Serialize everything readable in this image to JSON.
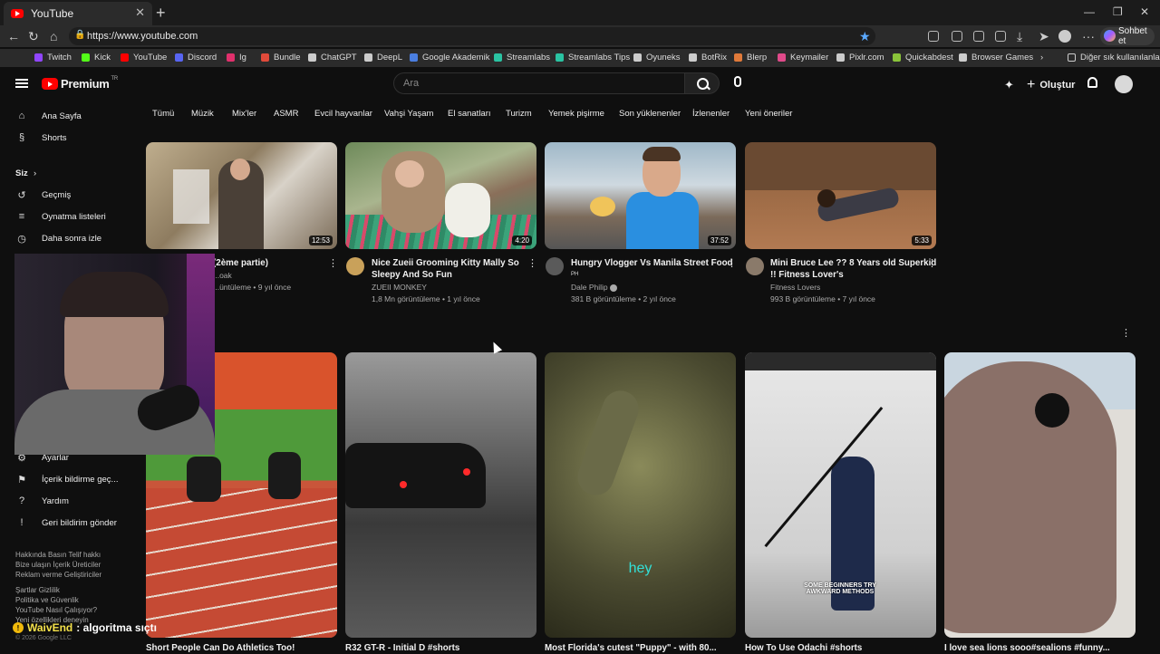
{
  "browser": {
    "tab_title": "YouTube",
    "url": "https://www.youtube.com",
    "copilot_label": "Sohbet et",
    "bookmarks": [
      "Twitch",
      "Kick",
      "YouTube",
      "Discord",
      "Ig",
      "Bundle",
      "ChatGPT",
      "DeepL",
      "Google Akademik",
      "Streamlabs",
      "Streamlabs Tips",
      "Oyuneks",
      "BotRix",
      "Blerp",
      "Keymailer",
      "Pixlr.com",
      "Quickabdest",
      "Browser Games"
    ],
    "other_bookmarks": "Diğer sık kullanılanlar",
    "colors": {
      "twitch": "#9146ff",
      "kick": "#53fc18",
      "youtube": "#ff0000",
      "discord": "#5865f2",
      "ig": "#e1306c"
    }
  },
  "header": {
    "logo_text": "Premium",
    "logo_sup": "TR",
    "search_placeholder": "Ara",
    "create_label": "Oluştur"
  },
  "sidebar": {
    "items": [
      {
        "label": "Ana Sayfa",
        "icon": "home-icon"
      },
      {
        "label": "Shorts",
        "icon": "shorts-icon"
      }
    ],
    "you_label": "Siz",
    "you_items": [
      {
        "label": "Geçmiş",
        "icon": "history-icon"
      },
      {
        "label": "Oynatma listeleri",
        "icon": "playlist-icon"
      },
      {
        "label": "Daha sonra izle",
        "icon": "clock-icon"
      }
    ],
    "bottom_items": [
      {
        "label": "Ayarlar",
        "icon": "gear-icon"
      },
      {
        "label": "İçerik bildirme geç...",
        "icon": "flag-icon"
      },
      {
        "label": "Yardım",
        "icon": "help-icon"
      },
      {
        "label": "Geri bildirim gönder",
        "icon": "feedback-icon"
      }
    ],
    "footer_1": [
      "Hakkında  Basın  Telif hakkı",
      "Bize ulaşın  İçerik Üreticiler",
      "Reklam verme  Geliştiriciler"
    ],
    "footer_2": [
      "Şartlar  Gizlilik",
      "Politika ve Güvenlik",
      "YouTube Nasıl Çalışıyor?",
      "Yeni özellikleri deneyin"
    ],
    "copyright": "© 2026 Google LLC"
  },
  "chips": [
    "Tümü",
    "Müzik",
    "Mix'ler",
    "ASMR",
    "Evcil hayvanlar",
    "Vahşi Yaşam",
    "El sanatları",
    "Turizm",
    "Yemek pişirme",
    "Son yüklenenler",
    "İzlenenler",
    "Yeni öneriler"
  ],
  "videos": [
    {
      "title": "(2ème partie)",
      "channel": "...oak",
      "meta": "...üntüleme • 9 yıl önce",
      "duration": "12:53"
    },
    {
      "title_line1": "Nice Zueii Grooming Kitty Mally So",
      "title_line2": "Sleepy And So Fun",
      "channel": "ZUEII MONKEY",
      "meta": "1,8 Mn görüntüleme • 1 yıl önce",
      "duration": "4:20"
    },
    {
      "title": "Hungry Vlogger Vs Manila Street Food",
      "channel": "Dale Philip",
      "meta": "381 B görüntüleme • 2 yıl önce",
      "duration": "37:52",
      "avatar_text": "PH"
    },
    {
      "title_line1": "Mini Bruce Lee ?? 8 Years old Superkid",
      "title_line2": "!! Fitness Lover's",
      "channel": "Fitness Lovers",
      "meta": "993 B görüntüleme • 7 yıl önce",
      "duration": "5:33"
    }
  ],
  "shorts": [
    {
      "title": "Short People Can Do Athletics Too!"
    },
    {
      "title": "R32 GT-R - Initial D #shorts"
    },
    {
      "title": "Most Florida's cutest \"Puppy\" - with 80...",
      "overlay": "hey"
    },
    {
      "title": "How To Use Odachi #shorts",
      "overlay": "SOME BEGINNERS TRY AWKWARD METHODS"
    },
    {
      "title": "I love sea lions sooo#sealions #funny..."
    }
  ],
  "chat": {
    "user": "WaivEnd",
    "message": ": algoritma sıçtı"
  }
}
